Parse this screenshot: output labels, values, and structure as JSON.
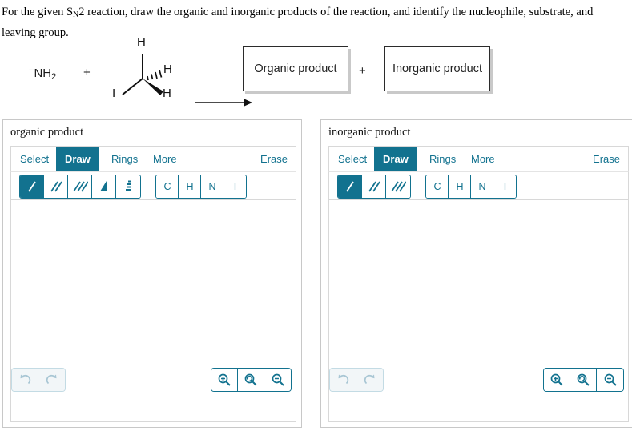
{
  "prompt": {
    "before_sub": "For the given S",
    "sub": "N",
    "after_sub": "2 reaction, draw the organic and inorganic products of the reaction, and identify the nucleophile, substrate, and leaving group."
  },
  "reaction": {
    "nucleophile": {
      "charge": "−",
      "formula_main": "NH",
      "formula_sub": "2"
    },
    "plus_first": "+",
    "plus_second": "+",
    "substrate": {
      "name": "methyl iodide",
      "atom_top": "H",
      "atom_hash": "H",
      "atom_wedge": "H",
      "atom_leaving": "I"
    },
    "arrow": "reaction-arrow",
    "organic_product_box": "Organic product",
    "inorganic_product_box": "Inorganic product"
  },
  "colors": {
    "accent": "#12728f",
    "panel_border": "#c8c8c8",
    "disabled": "#a8c6d4"
  },
  "panels": [
    {
      "title": "organic product",
      "tabs": [
        {
          "label": "Select",
          "active": false
        },
        {
          "label": "Draw",
          "active": true
        },
        {
          "label": "Rings",
          "active": false
        },
        {
          "label": "More",
          "active": false
        }
      ],
      "erase_label": "Erase",
      "bond_tools": [
        {
          "name": "single-bond",
          "active": true
        },
        {
          "name": "double-bond",
          "active": false
        },
        {
          "name": "triple-bond",
          "active": false
        },
        {
          "name": "wedge-bond",
          "active": false
        },
        {
          "name": "hash-bond",
          "active": false
        }
      ],
      "elements": [
        "C",
        "H",
        "N",
        "I"
      ],
      "undo_label": "undo",
      "redo_label": "redo",
      "zoom_in_label": "zoom-in",
      "zoom_reset_label": "zoom-reset",
      "zoom_out_label": "zoom-out"
    },
    {
      "title": "inorganic product",
      "tabs": [
        {
          "label": "Select",
          "active": false
        },
        {
          "label": "Draw",
          "active": true
        },
        {
          "label": "Rings",
          "active": false
        },
        {
          "label": "More",
          "active": false
        }
      ],
      "erase_label": "Erase",
      "bond_tools": [
        {
          "name": "single-bond",
          "active": true
        },
        {
          "name": "double-bond",
          "active": false
        },
        {
          "name": "triple-bond",
          "active": false
        }
      ],
      "elements": [
        "C",
        "H",
        "N",
        "I"
      ],
      "undo_label": "undo",
      "redo_label": "redo",
      "zoom_in_label": "zoom-in",
      "zoom_reset_label": "zoom-reset",
      "zoom_out_label": "zoom-out"
    }
  ]
}
